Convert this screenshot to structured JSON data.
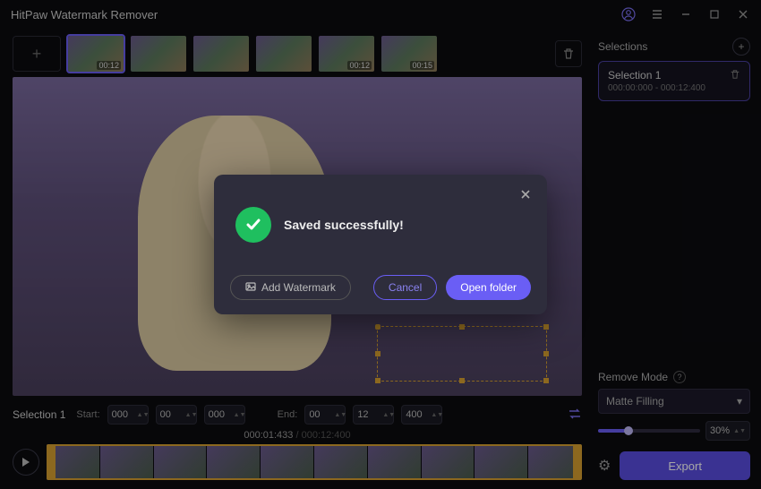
{
  "app": {
    "title": "HitPaw Watermark Remover"
  },
  "thumbs": [
    {
      "duration": "00:12",
      "selected": true
    },
    {
      "duration": ""
    },
    {
      "duration": ""
    },
    {
      "duration": ""
    },
    {
      "duration": "00:12"
    },
    {
      "duration": "00:15"
    }
  ],
  "timecode": {
    "selection_label": "Selection 1",
    "start_label": "Start:",
    "end_label": "End:",
    "start": [
      "000",
      "00",
      "000"
    ],
    "end": [
      "00",
      "12",
      "400"
    ]
  },
  "timeline": {
    "current": "000:01:433",
    "total": "000:12:400"
  },
  "selections": {
    "header": "Selections",
    "items": [
      {
        "title": "Selection 1",
        "range": "000:00:000 - 000:12:400"
      }
    ]
  },
  "remove_mode": {
    "header": "Remove Mode",
    "selected": "Matte Filling",
    "percent": "30%"
  },
  "export_label": "Export",
  "modal": {
    "message": "Saved successfully!",
    "add_watermark": "Add Watermark",
    "cancel": "Cancel",
    "open_folder": "Open folder"
  }
}
